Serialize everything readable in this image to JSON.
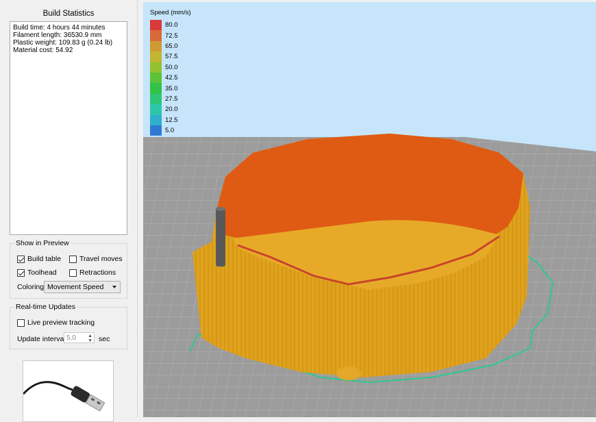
{
  "build_statistics": {
    "title": "Build Statistics",
    "lines": [
      "Build time: 4 hours 44 minutes",
      "Filament length: 36530.9 mm",
      "Plastic weight: 109.83 g (0.24 lb)",
      "Material cost: 54.92"
    ]
  },
  "show_in_preview": {
    "title": "Show in Preview",
    "build_table": {
      "label": "Build table",
      "checked": true
    },
    "travel_moves": {
      "label": "Travel moves",
      "checked": false
    },
    "toolhead": {
      "label": "Toolhead",
      "checked": true
    },
    "retractions": {
      "label": "Retractions",
      "checked": false
    },
    "coloring_label": "Coloring",
    "coloring_value": "Movement Speed"
  },
  "realtime_updates": {
    "title": "Real-time Updates",
    "live_preview": {
      "label": "Live preview tracking",
      "checked": false
    },
    "update_interval_label": "Update interval",
    "update_interval_value": "5,0",
    "update_interval_unit": "sec"
  },
  "thumbnail": {
    "icon": "usb-cable-icon"
  },
  "legend": {
    "title": "Speed (mm/s)",
    "entries": [
      {
        "value": "80.0",
        "color": "#d93a3a"
      },
      {
        "value": "72.5",
        "color": "#d76a38"
      },
      {
        "value": "65.0",
        "color": "#cf9a33"
      },
      {
        "value": "57.5",
        "color": "#c2b52f"
      },
      {
        "value": "50.0",
        "color": "#93c12f"
      },
      {
        "value": "42.5",
        "color": "#5cc23a"
      },
      {
        "value": "35.0",
        "color": "#31c247"
      },
      {
        "value": "27.5",
        "color": "#2fc476"
      },
      {
        "value": "20.0",
        "color": "#2ec6a8"
      },
      {
        "value": "12.5",
        "color": "#30aecb"
      },
      {
        "value": "5.0",
        "color": "#2f7ad0"
      }
    ]
  },
  "colors": {
    "sky": "#c6e5fb",
    "build_plate": "#9c9c9c",
    "part_outer": "#e0a21c",
    "part_inner": "#df5b14",
    "skirt": "#2ec98c",
    "toolhead": "#585858"
  }
}
